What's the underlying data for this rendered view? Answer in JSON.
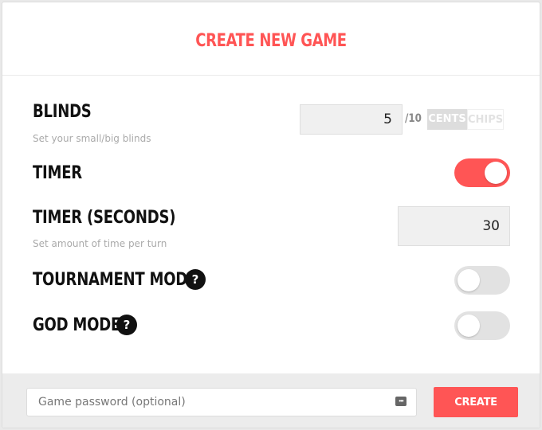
{
  "dialog": {
    "title": "CREATE NEW GAME"
  },
  "settings": {
    "blinds": {
      "label": "BLINDS",
      "hint": "Set your small/big blinds",
      "small_blind_value": "5",
      "big_blind_suffix": "/10",
      "unit_options": [
        "CENTS",
        "CHIPS"
      ],
      "selected_unit": "CENTS"
    },
    "timer": {
      "label": "TIMER",
      "enabled": true
    },
    "timer_seconds": {
      "label": "TIMER (SECONDS)",
      "hint": "Set amount of time per turn",
      "value": "30"
    },
    "tournament_mode": {
      "label": "TOURNAMENT MODE",
      "help_glyph": "?",
      "enabled": false
    },
    "god_mode": {
      "label": "GOD MODE",
      "help_glyph": "?",
      "enabled": false
    }
  },
  "footer": {
    "password_placeholder": "Game password (optional)",
    "password_value": "",
    "password_icon": "password-manager-icon",
    "create_label": "CREATE"
  },
  "colors": {
    "accent": "#ff5555",
    "toggle_off": "#e2e2e2",
    "footer_bg": "#ececec"
  }
}
